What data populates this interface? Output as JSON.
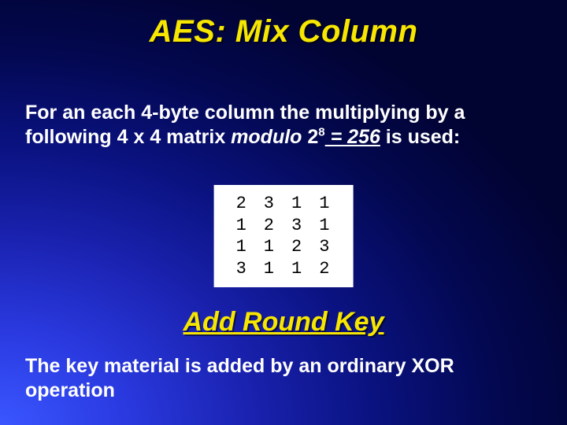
{
  "title": "AES: Mix Column",
  "para1_a": "For an each 4-byte column the multiplying by a following 4 x 4 matrix ",
  "para1_modulo": "modulo",
  "para1_b": " 2",
  "para1_sup": "8",
  "para1_c": " = 256",
  "para1_d": " is used:",
  "matrix": {
    "rows": [
      [
        "2",
        "3",
        "1",
        "1"
      ],
      [
        "1",
        "2",
        "3",
        "1"
      ],
      [
        "1",
        "1",
        "2",
        "3"
      ],
      [
        "3",
        "1",
        "1",
        "2"
      ]
    ]
  },
  "subtitle": "Add Round Key",
  "para2": "The key material is added by an ordinary XOR operation"
}
